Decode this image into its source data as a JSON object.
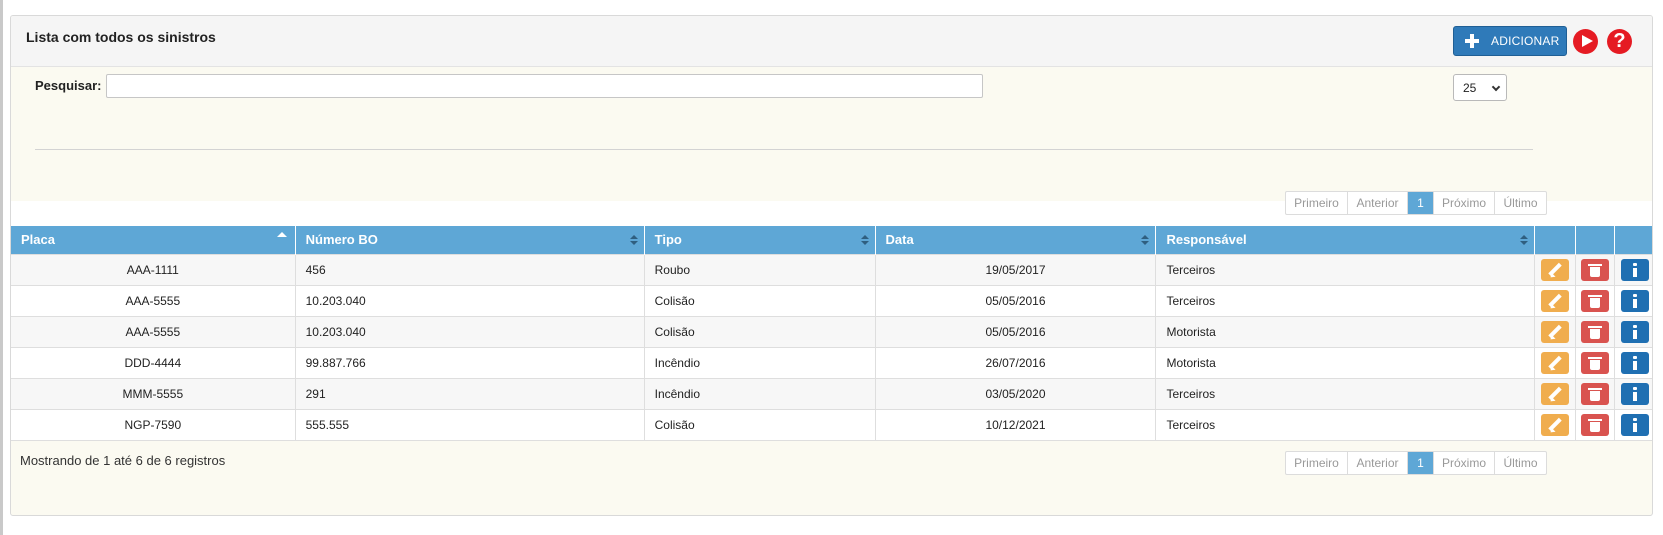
{
  "panel": {
    "title": "Lista com todos os sinistros",
    "add_button_label": "ADICIONAR",
    "help_symbol": "?"
  },
  "search": {
    "label": "Pesquisar:",
    "value": "",
    "page_size": "25"
  },
  "pagination": {
    "first": "Primeiro",
    "previous": "Anterior",
    "current": "1",
    "next": "Próximo",
    "last": "Último"
  },
  "table": {
    "headers": [
      "Placa",
      "Número BO",
      "Tipo",
      "Data",
      "Responsável"
    ],
    "rows": [
      [
        "AAA-1111",
        "456",
        "Roubo",
        "19/05/2017",
        "Terceiros"
      ],
      [
        "AAA-5555",
        "10.203.040",
        "Colisão",
        "05/05/2016",
        "Terceiros"
      ],
      [
        "AAA-5555",
        "10.203.040",
        "Colisão",
        "05/05/2016",
        "Motorista"
      ],
      [
        "DDD-4444",
        "99.887.766",
        "Incêndio",
        "26/07/2016",
        "Motorista"
      ],
      [
        "MMM-5555",
        "291",
        "Incêndio",
        "03/05/2020",
        "Terceiros"
      ],
      [
        "NGP-7590",
        "555.555",
        "Colisão",
        "10/12/2021",
        "Terceiros"
      ]
    ]
  },
  "footer": {
    "info": "Mostrando de 1 até 6 de 6 registros"
  },
  "icons": [
    "plus-icon",
    "play-icon",
    "help-icon",
    "sort-asc-icon",
    "sort-icon",
    "pencil-icon",
    "trash-icon",
    "info-icon",
    "chevron-down-icon"
  ],
  "colors": {
    "header_blue": "#5ea7d6",
    "add_button": "#2f7ab9",
    "edit": "#f0ad4e",
    "delete": "#d9534f",
    "info": "#1f6fb2",
    "help_red": "#e51b23"
  }
}
